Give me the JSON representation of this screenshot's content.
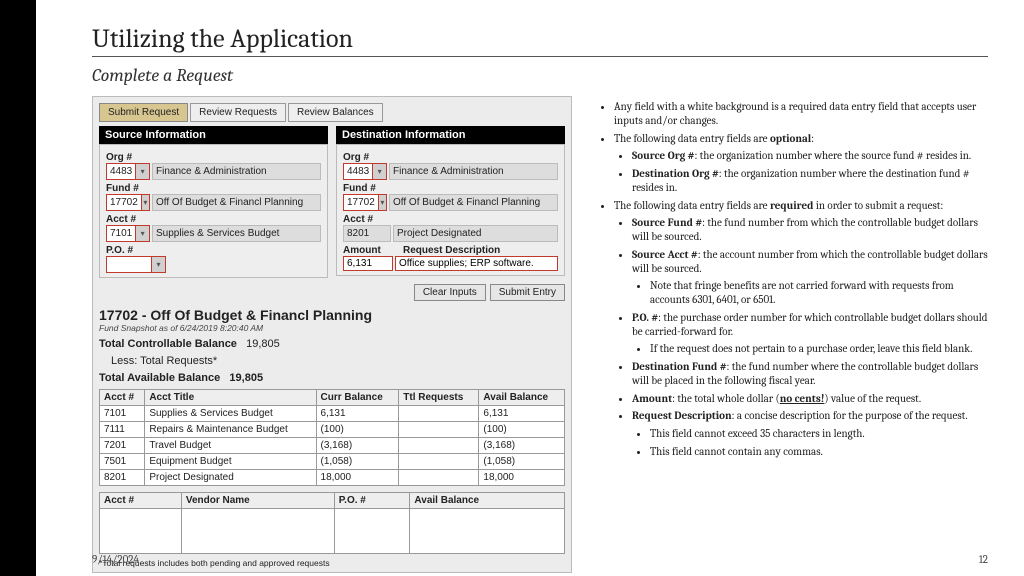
{
  "title": "Utilizing the Application",
  "subtitle": "Complete a Request",
  "footer": {
    "date": "9/14/2024",
    "page": "12"
  },
  "tabs": [
    "Submit Request",
    "Review Requests",
    "Review Balances"
  ],
  "src": {
    "hdr": "Source Information",
    "org_lbl": "Org #",
    "org_val": "4483",
    "org_ro": "Finance & Administration",
    "fund_lbl": "Fund #",
    "fund_val": "17702",
    "fund_ro": "Off Of Budget & Financl Planning",
    "acct_lbl": "Acct #",
    "acct_val": "7101",
    "acct_ro": "Supplies & Services Budget",
    "po_lbl": "P.O. #",
    "po_val": ""
  },
  "dst": {
    "hdr": "Destination Information",
    "org_lbl": "Org #",
    "org_val": "4483",
    "org_ro": "Finance & Administration",
    "fund_lbl": "Fund #",
    "fund_val": "17702",
    "fund_ro": "Off Of Budget & Financl Planning",
    "acct_lbl": "Acct #",
    "acct_val": "8201",
    "acct_ro": "Project Designated",
    "amt_lbl": "Amount",
    "amt_val": "6,131",
    "desc_lbl": "Request Description",
    "desc_val": "Office supplies; ERP software."
  },
  "btns": {
    "clear": "Clear Inputs",
    "submit": "Submit Entry"
  },
  "fund_title": "17702 - Off Of Budget & Financl Planning",
  "snapshot": "Fund Snapshot as of 6/24/2019 8:20:40 AM",
  "bal": {
    "tcb_lbl": "Total Controllable Balance",
    "tcb": "19,805",
    "less_lbl": "Less: Total Requests*",
    "tab_lbl": "Total Available Balance",
    "tab": "19,805"
  },
  "tbl": {
    "h": [
      "Acct #",
      "Acct Title",
      "Curr Balance",
      "Ttl Requests",
      "Avail Balance"
    ],
    "r": [
      [
        "7101",
        "Supplies & Services Budget",
        "6,131",
        "",
        "6,131"
      ],
      [
        "7111",
        "Repairs & Maintenance Budget",
        "(100)",
        "",
        "(100)"
      ],
      [
        "7201",
        "Travel Budget",
        "(3,168)",
        "",
        "(3,168)"
      ],
      [
        "7501",
        "Equipment Budget",
        "(1,058)",
        "",
        "(1,058)"
      ],
      [
        "8201",
        "Project Designated",
        "18,000",
        "",
        "18,000"
      ]
    ]
  },
  "vtbl": {
    "h": [
      "Acct #",
      "Vendor Name",
      "P.O. #",
      "Avail Balance"
    ]
  },
  "footnote": "*Total requests includes both pending and approved requests",
  "notes": {
    "intro": "Any field with a white background is a required data entry field that accepts user inputs and/or changes.",
    "opt_intro_a": "The following data entry fields are ",
    "opt_intro_b": "optional",
    "opt_intro_c": ":",
    "opt1a": "Source Org #",
    "opt1b": ": the organization number where the source fund # resides in.",
    "opt2a": "Destination Org #",
    "opt2b": ": the organization number where the destination fund # resides in.",
    "req_intro_a": "The following data entry fields are ",
    "req_intro_b": "required",
    "req_intro_c": " in order to submit a request:",
    "r1a": "Source Fund #",
    "r1b": ": the fund number from which the controllable budget dollars will be sourced.",
    "r2a": "Source Acct #",
    "r2b": ": the account number from which the controllable budget dollars will be sourced.",
    "r2n": "Note that fringe benefits are not carried forward with requests from accounts 6301, 6401, or 6501.",
    "r3a": "P.O. #",
    "r3b": ": the purchase order number for which controllable budget dollars should be carried-forward for.",
    "r3n": "If the request does not pertain to a purchase order, leave this field blank.",
    "r4a": "Destination Fund #",
    "r4b": ": the fund number where the controllable budget dollars will be placed in the following fiscal year.",
    "r5a": "Amount",
    "r5b": ": the total whole dollar (",
    "r5c": "no cents!",
    "r5d": ") value of the request.",
    "r6a": "Request Description",
    "r6b": ": a concise description for the purpose of the request.",
    "r6n1": "This field cannot exceed 35 characters in length.",
    "r6n2": "This field cannot contain any commas."
  }
}
